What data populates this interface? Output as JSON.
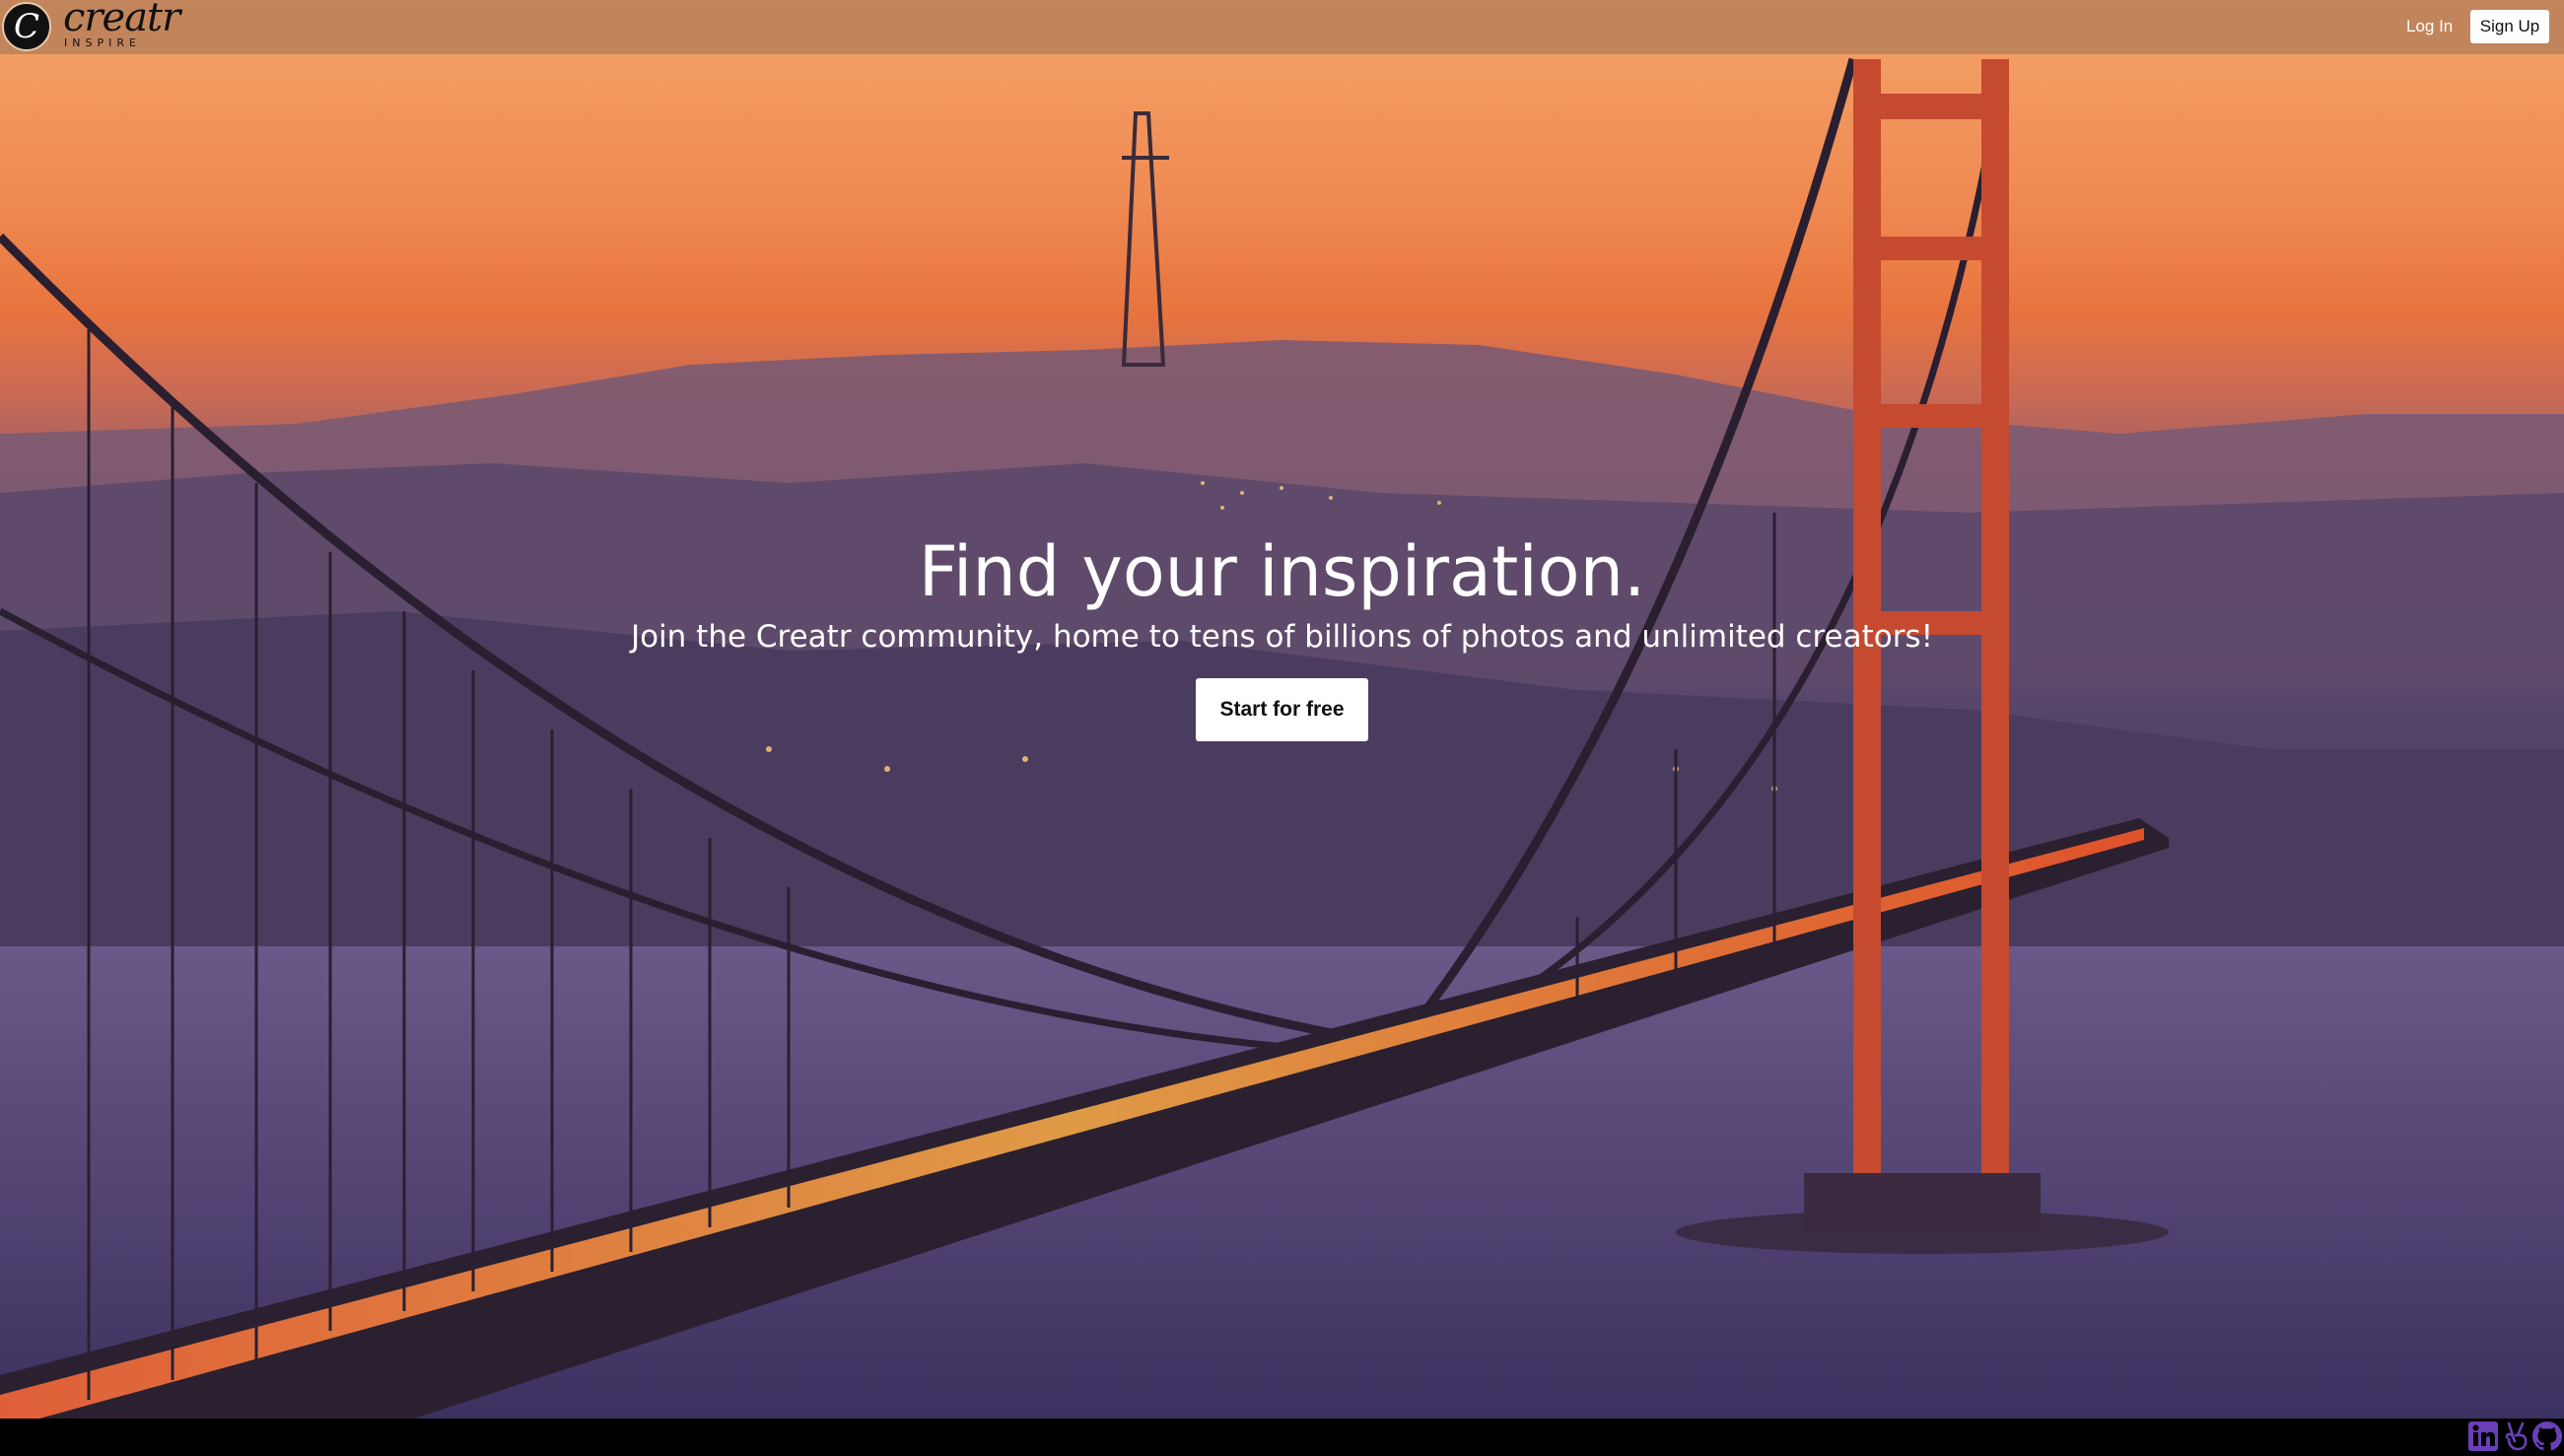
{
  "brand": {
    "logo_letter": "C",
    "name": "creatr",
    "tagline": "INSPIRE"
  },
  "nav": {
    "login_label": "Log In",
    "signup_label": "Sign Up"
  },
  "hero": {
    "headline": "Find your inspiration.",
    "subheadline": "Join the Creatr community, home to tens of billions of photos and unlimited creators!",
    "cta_label": "Start for free",
    "background": "Golden Gate Bridge at sunset"
  },
  "footer": {
    "icons": [
      "linkedin-icon",
      "angellist-icon",
      "github-icon"
    ],
    "icon_color": "#6a3fb8"
  },
  "colors": {
    "navbar": "#be825a",
    "button_bg": "#ffffff",
    "footer_bg": "#000000"
  }
}
